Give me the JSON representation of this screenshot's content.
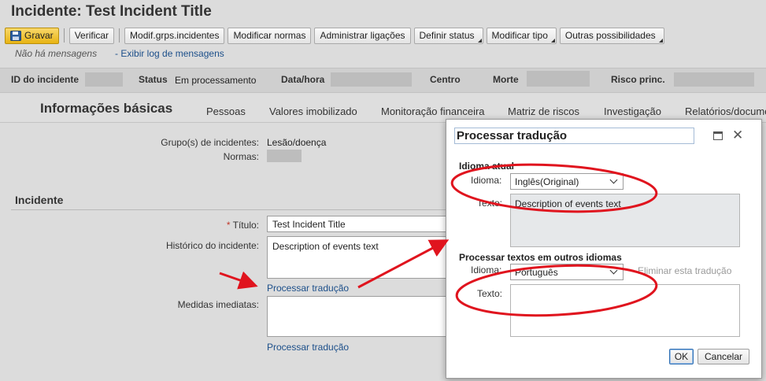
{
  "page": {
    "title": "Incidente: Test Incident Title"
  },
  "toolbar": {
    "save_label": "Gravar",
    "check_label": "Verificar",
    "modify_groups_label": "Modif.grps.incidentes",
    "modify_norms_label": "Modificar normas",
    "manage_links_label": "Administrar ligações",
    "set_status_label": "Definir status",
    "modify_type_label": "Modificar tipo",
    "more_label": "Outras possibilidades"
  },
  "messages": {
    "none_text": "Não há mensagens",
    "log_link": "Exibir log de mensagens"
  },
  "header": {
    "incident_id_label": "ID do incidente",
    "status_label": "Status",
    "status_value": "Em processamento",
    "datetime_label": "Data/hora",
    "center_label": "Centro",
    "death_label": "Morte",
    "main_risk_label": "Risco princ."
  },
  "tabs": [
    {
      "label": "Informações básicas"
    },
    {
      "label": "Pessoas"
    },
    {
      "label": "Valores imobilizado"
    },
    {
      "label": "Monitoração financeira"
    },
    {
      "label": "Matriz de riscos"
    },
    {
      "label": "Investigação"
    },
    {
      "label": "Relatórios/docume"
    }
  ],
  "form": {
    "groups_label": "Grupo(s) de incidentes:",
    "groups_value": "Lesão/doença",
    "norms_label": "Normas:",
    "section_title": "Incidente",
    "required_mark": "*",
    "title_label": "Título:",
    "title_value": "Test Incident Title",
    "history_label": "Histórico do incidente:",
    "history_value": "Description of events text",
    "translate_link_1": "Processar tradução",
    "immediate_label": "Medidas imediatas:",
    "immediate_value": "",
    "translate_link_2": "Processar tradução"
  },
  "dialog": {
    "title": "Processar tradução",
    "current_group": "Idioma atual",
    "language_label": "Idioma:",
    "current_language": "Inglês(Original)",
    "text_label": "Texto:",
    "current_text": "Description of events text",
    "other_group": "Processar textos em outros idiomas",
    "other_language_label": "Idioma:",
    "other_language": "Português",
    "delete_link": "Eliminar esta tradução",
    "other_text_label": "Texto:",
    "other_text": "",
    "ok_label": "OK",
    "cancel_label": "Cancelar"
  },
  "colors": {
    "primary_button": "#e8b414",
    "link": "#1c4f8a",
    "annotation_red": "#e0141e",
    "background": "#dcdcdc"
  }
}
